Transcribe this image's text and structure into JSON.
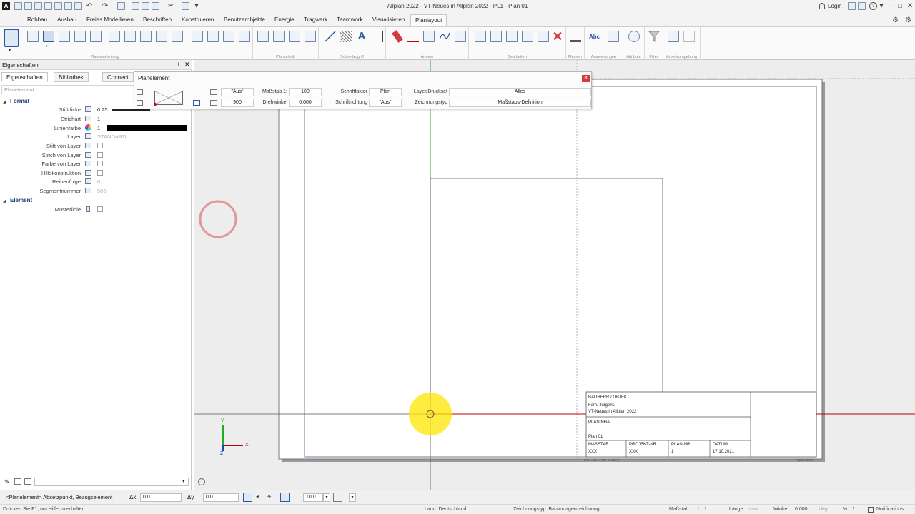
{
  "window": {
    "title": "Allplan 2022 - VT-Neues in Allplan 2022 - PL1 - Plan 01",
    "login": "Login",
    "help": "?"
  },
  "menu": {
    "tabs": [
      "Rohbau",
      "Ausbau",
      "Freies Modellieren",
      "Beschriften",
      "Konstruieren",
      "Benutzerobjekte",
      "Energie",
      "Tragwerk",
      "Teamwork",
      "Visualisieren",
      "Planlayout"
    ],
    "active": "Planlayout"
  },
  "ribbon": {
    "groups": [
      "Planbearbeitung",
      "Planschnitt",
      "Schnellzugriff",
      "Ändern",
      "Bearbeiten",
      "Messen",
      "Auswertungen",
      "Attribute",
      "Filter",
      "Arbeitsumgebung"
    ],
    "abc_label": "Abc"
  },
  "panel": {
    "title": "Eigenschaften",
    "tabs": [
      "Eigenschaften",
      "Bibliothek",
      "Connect"
    ],
    "search_placeholder": "Planelement",
    "format_section": "Format",
    "element_section": "Element",
    "props": [
      {
        "label": "Stiftdicke",
        "value": "0.25"
      },
      {
        "label": "Strichart",
        "value": "1"
      },
      {
        "label": "Linienfarbe",
        "value": "1"
      },
      {
        "label": "Layer",
        "value": "STANDARD"
      },
      {
        "label": "Stift von Layer",
        "value": ""
      },
      {
        "label": "Strich von Layer",
        "value": ""
      },
      {
        "label": "Farbe von Layer",
        "value": ""
      },
      {
        "label": "Hilfskonstruktion",
        "value": ""
      },
      {
        "label": "Reihenfolge",
        "value": "0"
      },
      {
        "label": "Segmentnummer",
        "value": "506"
      }
    ],
    "element_props": [
      {
        "label": "Musterlinie",
        "value": ""
      }
    ]
  },
  "dialog": {
    "title": "Planelement",
    "aus1": "\"Aus\"",
    "val900": "900",
    "massstab_label": "Maßstab 1:",
    "massstab_value": "100",
    "drehwinkel_label": "Drehwinkel",
    "drehwinkel_value": "0.000",
    "schriftfaktor_label": "Schriftfaktor",
    "schriftfaktor_value": "Plan",
    "schriftrichtung_label": "Schriftrichtung",
    "schriftrichtung_value": "\"Aus\"",
    "layer_label": "Layer/Druckset",
    "layer_value": "Alles",
    "zeichnungstyp_label": "Zeichnungstyp",
    "zeichnungstyp_value": "Maßstabs-Definition"
  },
  "titleblock": {
    "bauherr_label": "BAUHERR / OBJEKT",
    "bauherr_name": "Fam. Jürgens",
    "objekt": "VT-Neues in Allplan 2022",
    "planinhalt_label": "PLANINHALT",
    "planinhalt_value": "Plan 01",
    "massstab_label": "MASSTAB",
    "massstab_value": "XXX",
    "projekt_label": "PROJEKT-NR.",
    "projekt_value": "XXX",
    "plannr_label": "PLAN-NR.",
    "plannr_value": "1",
    "datum_label": "DATUM",
    "datum_value": "17.10.2021",
    "footer_left": "H/B = 297 / 420 (0.12m²)",
    "footer_right": "Allplan 2022"
  },
  "axes": {
    "y": "Y",
    "x": "X",
    "z": "Z"
  },
  "command": {
    "prompt": "<Planelement> Absetzpunkt, Bezugselement",
    "dx_label": "Δx",
    "dx_value": "0.0",
    "dy_label": "Δy",
    "dy_value": "0.0",
    "snap_value": "10.0"
  },
  "status": {
    "hint": "Drücken Sie F1, um Hilfe zu erhalten.",
    "land": "Land:  Deutschland",
    "zeichnungstyp": "Zeichnungstyp:  Bauvorlagenzeichnung",
    "massstab_label": "Maßstab:",
    "massstab_value": "1 : 1",
    "laenge_label": "Länge:",
    "laenge_value": "mm",
    "winkel_label": "Winkel:",
    "winkel_value": "0.000",
    "winkel_unit": "deg",
    "percent": "%",
    "percent_value": "1",
    "notifications": "Notifications"
  },
  "colors": {
    "accent": "#1c3f73",
    "red_line": "#c00000",
    "green_line": "#22aa22",
    "highlight_yellow": "#ffe600",
    "cursor_ring": "#e08080"
  }
}
